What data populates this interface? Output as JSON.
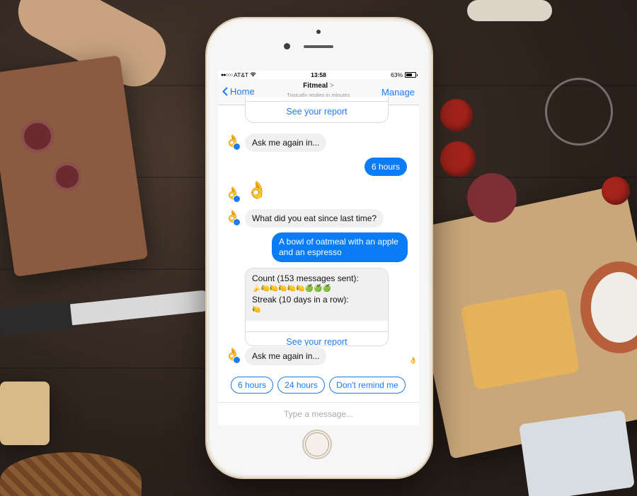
{
  "status_bar": {
    "signal": "●●○○○",
    "carrier": "AT&T",
    "time": "13:58",
    "battery": "63%"
  },
  "nav": {
    "back_label": "Home",
    "title": "Fitmeal",
    "title_chevron": ">",
    "subtitle": "Typically replies in minutes",
    "manage_label": "Manage"
  },
  "messages": {
    "report_link_1": "See your report",
    "ask_again_1": "Ask me again in...",
    "user_reply_1": "6 hours",
    "ok_emoji": "👌",
    "what_did_you_eat": "What did you eat since last time?",
    "user_meal": "A bowl of oatmeal with an apple and an espresso",
    "count_label": "Count (153 messages sent):",
    "count_emojis": "🍌🍋🍋🍋🍋🍋🍏🍏🍏",
    "streak_label": "Streak (10 days in a row):",
    "streak_emoji": "🍋",
    "report_link_2": "See your report",
    "ask_again_2": "Ask me again in..."
  },
  "quick_replies": [
    "6 hours",
    "24 hours",
    "Don't remind me"
  ],
  "composer": {
    "placeholder": "Type a message..."
  },
  "icons": {
    "bot_avatar": "ok-hand-icon",
    "messenger_badge": "messenger-badge-icon",
    "back": "chevron-left-icon",
    "wifi": "wifi-icon",
    "battery": "battery-icon"
  },
  "colors": {
    "accent": "#1e7bf0",
    "outgoing_bubble": "#0a7cf5",
    "incoming_bubble": "#f0f0f0"
  }
}
